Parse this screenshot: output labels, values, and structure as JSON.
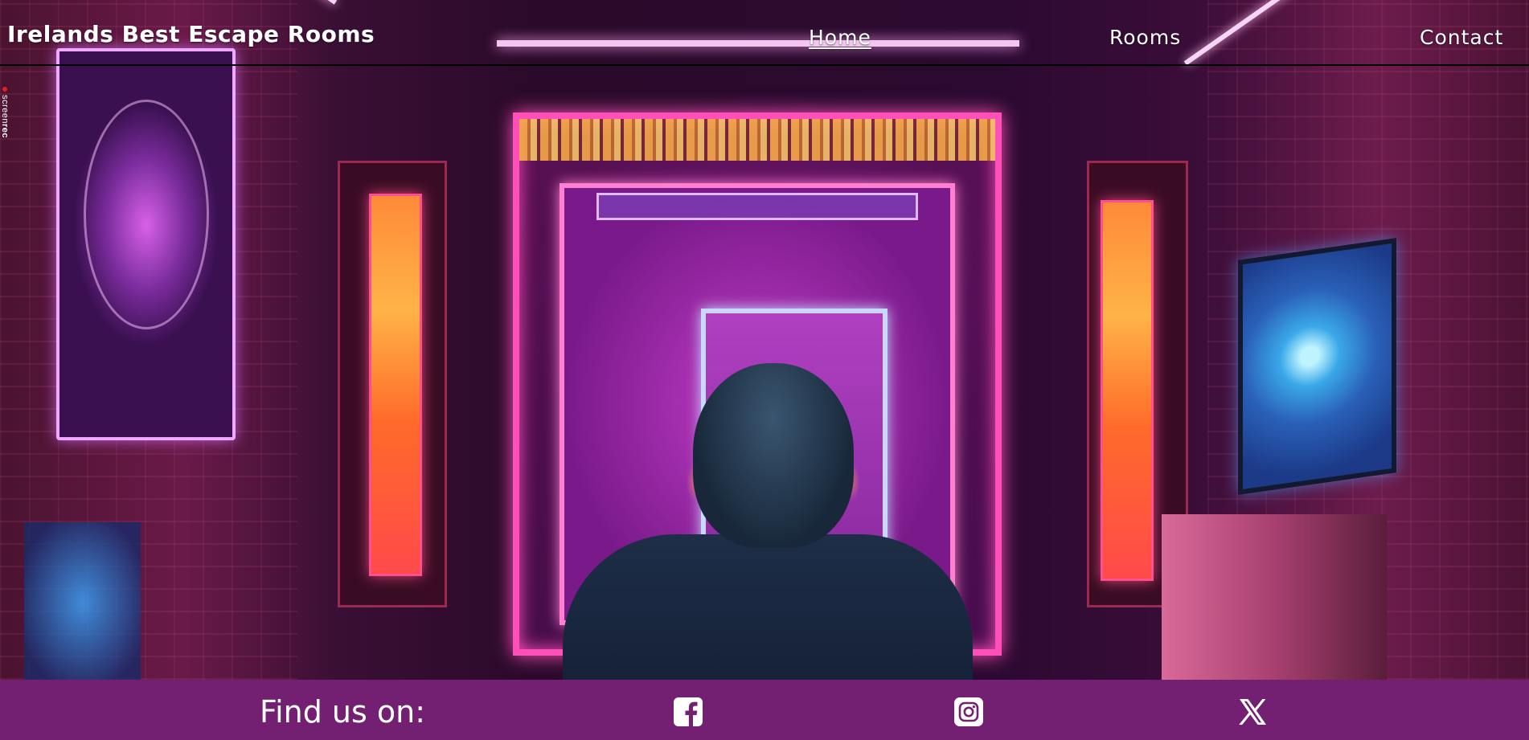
{
  "header": {
    "brand": "Irelands Best Escape Rooms",
    "nav": [
      {
        "label": "Home",
        "active": true
      },
      {
        "label": "Rooms",
        "active": false
      },
      {
        "label": "Contact",
        "active": false
      }
    ]
  },
  "hero": {
    "image": "neon-escape-room-photo"
  },
  "watermark": {
    "text_part1": "screen",
    "text_part2": "rec"
  },
  "footer": {
    "find_us_label": "Find us on:",
    "social": [
      {
        "icon": "facebook-icon"
      },
      {
        "icon": "instagram-icon"
      },
      {
        "icon": "x-icon"
      }
    ]
  },
  "colors": {
    "footer_bg": "#742072",
    "text": "#ffffff",
    "header_border": "#000000"
  }
}
